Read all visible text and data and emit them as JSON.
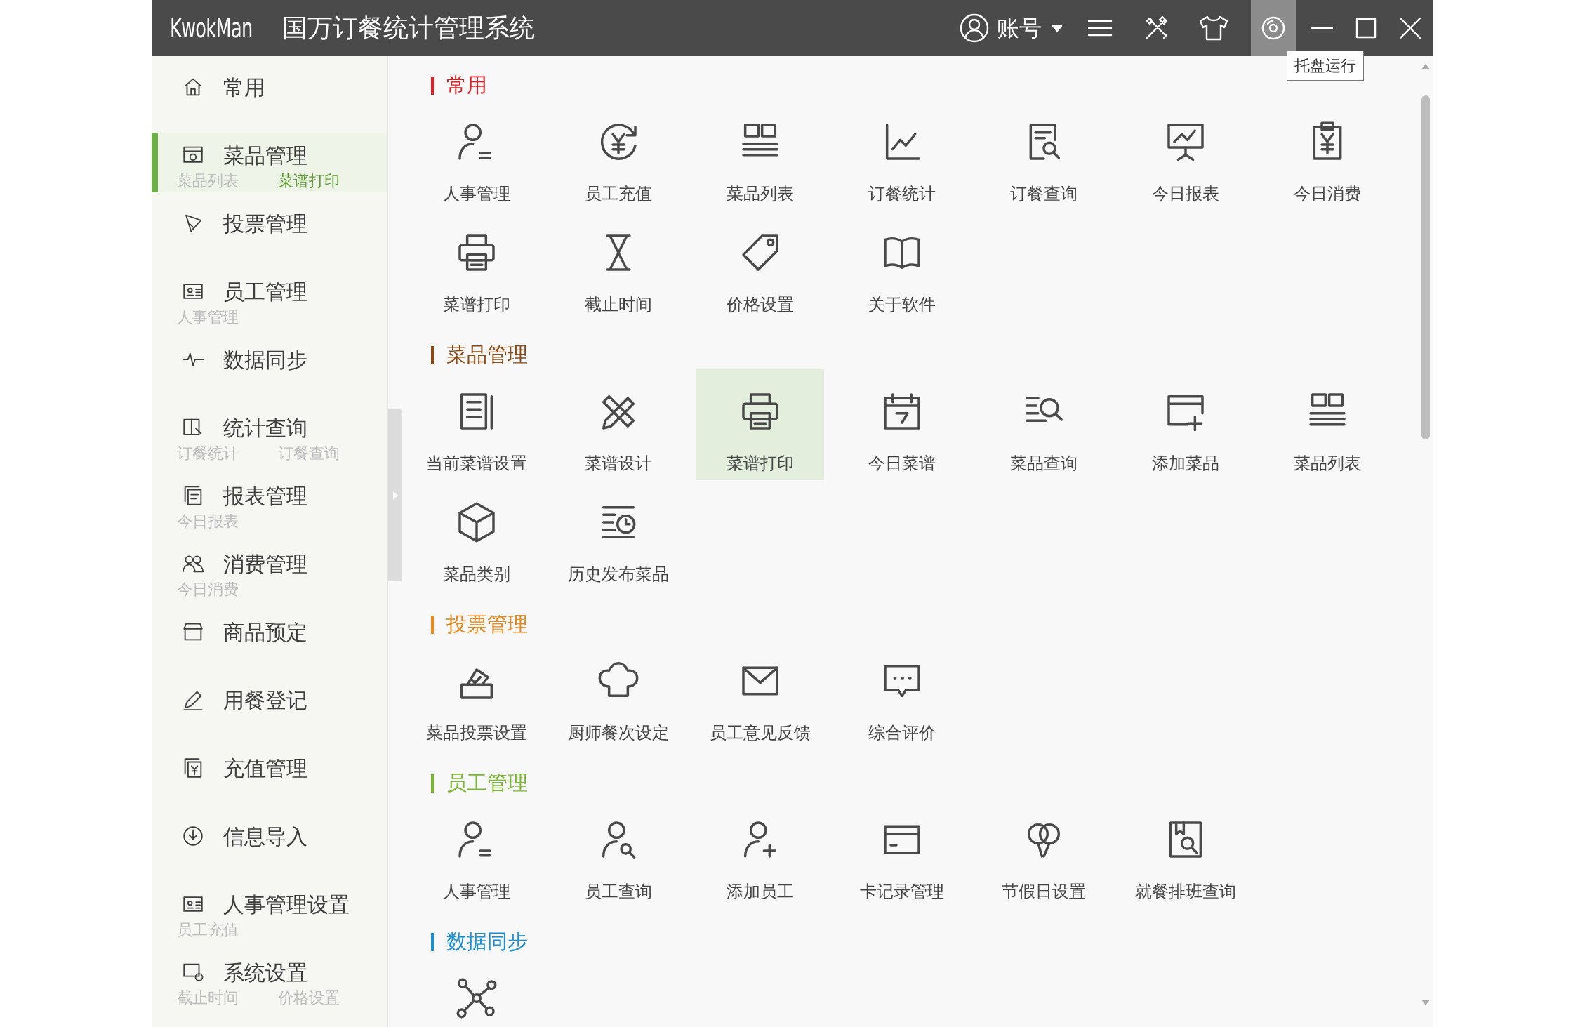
{
  "window": {
    "logo": "KwokMan",
    "title": "国万订餐统计管理系统",
    "account": "账号",
    "tray_button": {
      "highlighted": true
    },
    "tooltip": "托盘运行"
  },
  "sidebar": {
    "items": [
      {
        "label": "常用",
        "selected": false
      },
      {
        "label": "菜品管理",
        "selected": true,
        "links": [
          {
            "label": "菜品列表",
            "selected": false
          },
          {
            "label": "菜谱打印",
            "selected": true
          }
        ]
      },
      {
        "label": "投票管理",
        "selected": false
      },
      {
        "label": "员工管理",
        "selected": false,
        "links": [
          {
            "label": "人事管理",
            "selected": false
          }
        ]
      },
      {
        "label": "数据同步",
        "selected": false
      },
      {
        "label": "统计查询",
        "selected": false,
        "links": [
          {
            "label": "订餐统计",
            "selected": false
          },
          {
            "label": "订餐查询",
            "selected": false
          }
        ]
      },
      {
        "label": "报表管理",
        "selected": false,
        "links": [
          {
            "label": "今日报表",
            "selected": false
          }
        ]
      },
      {
        "label": "消费管理",
        "selected": false,
        "links": [
          {
            "label": "今日消费",
            "selected": false
          }
        ]
      },
      {
        "label": "商品预定",
        "selected": false
      },
      {
        "label": "用餐登记",
        "selected": false
      },
      {
        "label": "充值管理",
        "selected": false
      },
      {
        "label": "信息导入",
        "selected": false
      },
      {
        "label": "人事管理设置",
        "selected": false,
        "links": [
          {
            "label": "员工充值",
            "selected": false
          }
        ]
      },
      {
        "label": "系统设置",
        "selected": false,
        "links": [
          {
            "label": "截止时间",
            "selected": false
          },
          {
            "label": "价格设置",
            "selected": false
          }
        ]
      }
    ]
  },
  "sections": [
    {
      "title": "常用",
      "color": "#d8232a",
      "items": [
        {
          "label": "人事管理",
          "selected": false
        },
        {
          "label": "员工充值",
          "selected": false
        },
        {
          "label": "菜品列表",
          "selected": false
        },
        {
          "label": "订餐统计",
          "selected": false
        },
        {
          "label": "订餐查询",
          "selected": false
        },
        {
          "label": "今日报表",
          "selected": false
        },
        {
          "label": "今日消费",
          "selected": false
        },
        {
          "label": "菜谱打印",
          "selected": false
        },
        {
          "label": "截止时间",
          "selected": false
        },
        {
          "label": "价格设置",
          "selected": false
        },
        {
          "label": "关于软件",
          "selected": false
        }
      ]
    },
    {
      "title": "菜品管理",
      "color": "#8b4a14",
      "items": [
        {
          "label": "当前菜谱设置",
          "selected": false
        },
        {
          "label": "菜谱设计",
          "selected": false
        },
        {
          "label": "菜谱打印",
          "selected": true
        },
        {
          "label": "今日菜谱",
          "selected": false
        },
        {
          "label": "菜品查询",
          "selected": false
        },
        {
          "label": "添加菜品",
          "selected": false
        },
        {
          "label": "菜品列表",
          "selected": false
        },
        {
          "label": "菜品类别",
          "selected": false
        },
        {
          "label": "历史发布菜品",
          "selected": false
        }
      ]
    },
    {
      "title": "投票管理",
      "color": "#e8891a",
      "items": [
        {
          "label": "菜品投票设置",
          "selected": false
        },
        {
          "label": "厨师餐次设定",
          "selected": false
        },
        {
          "label": "员工意见反馈",
          "selected": false
        },
        {
          "label": "综合评价",
          "selected": false
        }
      ]
    },
    {
      "title": "员工管理",
      "color": "#7ab830",
      "items": [
        {
          "label": "人事管理",
          "selected": false
        },
        {
          "label": "员工查询",
          "selected": false
        },
        {
          "label": "添加员工",
          "selected": false
        },
        {
          "label": "卡记录管理",
          "selected": false
        },
        {
          "label": "节假日设置",
          "selected": false
        },
        {
          "label": "就餐排班查询",
          "selected": false
        }
      ]
    },
    {
      "title": "数据同步",
      "color": "#1c8fd2",
      "items": [
        {
          "selected": false
        }
      ]
    }
  ]
}
